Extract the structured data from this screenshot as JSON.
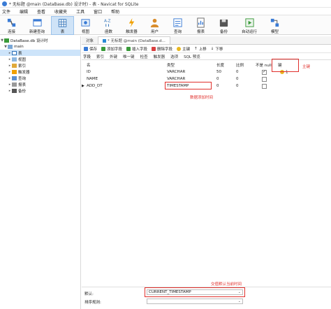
{
  "window": {
    "title": "* 无标题 @main (DataBase.db) 设计时) - 表 - Navicat for SQLite"
  },
  "menu": [
    "文件",
    "编辑",
    "查看",
    "收藏夹",
    "工具",
    "窗口",
    "帮助"
  ],
  "toolbar": [
    {
      "label": "连接",
      "icon": "connect-icon"
    },
    {
      "label": "新建查询",
      "icon": "new-query-icon"
    },
    {
      "label": "表",
      "icon": "table-icon"
    },
    {
      "label": "视图",
      "icon": "view-icon"
    },
    {
      "label": "函数",
      "icon": "function-icon"
    },
    {
      "label": "触发器",
      "icon": "trigger-icon"
    },
    {
      "label": "用户",
      "icon": "user-icon"
    },
    {
      "label": "查询",
      "icon": "query-icon"
    },
    {
      "label": "报表",
      "icon": "report-icon"
    },
    {
      "label": "备份",
      "icon": "backup-icon"
    },
    {
      "label": "自动运行",
      "icon": "auto-run-icon"
    },
    {
      "label": "模型",
      "icon": "model-icon"
    }
  ],
  "sidebar": {
    "connection": "DataBase.db 设计时",
    "schema": "main",
    "items": [
      "表",
      "视图",
      "索引",
      "触发器",
      "查询",
      "报表",
      "备份"
    ]
  },
  "tabs": {
    "objects": "对象",
    "editor": "* 无标题 @main (DataBase.d..."
  },
  "design_toolbar": [
    "保存",
    "添加字段",
    "插入字段",
    "删除字段",
    "主键",
    "上移",
    "下移"
  ],
  "subtabs": [
    "字段",
    "索引",
    "外键",
    "唯一键",
    "检查",
    "触发器",
    "选项",
    "SQL 预览"
  ],
  "grid": {
    "headers": {
      "name": "名",
      "type": "类型",
      "length": "长度",
      "decimals": "比例",
      "notnull": "不是 null",
      "key": "键"
    },
    "rows": [
      {
        "name": "ID",
        "type": "VARCHAR",
        "length": "50",
        "decimals": "0",
        "notnull": true,
        "key": "1"
      },
      {
        "name": "NAME",
        "type": "VARCHAR",
        "length": "0",
        "decimals": "0",
        "notnull": false,
        "key": ""
      },
      {
        "name": "ADD_DT",
        "type": "TIMESTAMP",
        "length": "0",
        "decimals": "0",
        "notnull": false,
        "key": ""
      }
    ]
  },
  "annotations": {
    "primary_key": "主键",
    "timestamp": "数据添加时间",
    "default": "交值默认当前时间"
  },
  "bottom": {
    "default_label": "默认:",
    "default_value": "CURRENT_TIMESTAMP",
    "collation_label": "排序规则:",
    "collation_value": ""
  }
}
